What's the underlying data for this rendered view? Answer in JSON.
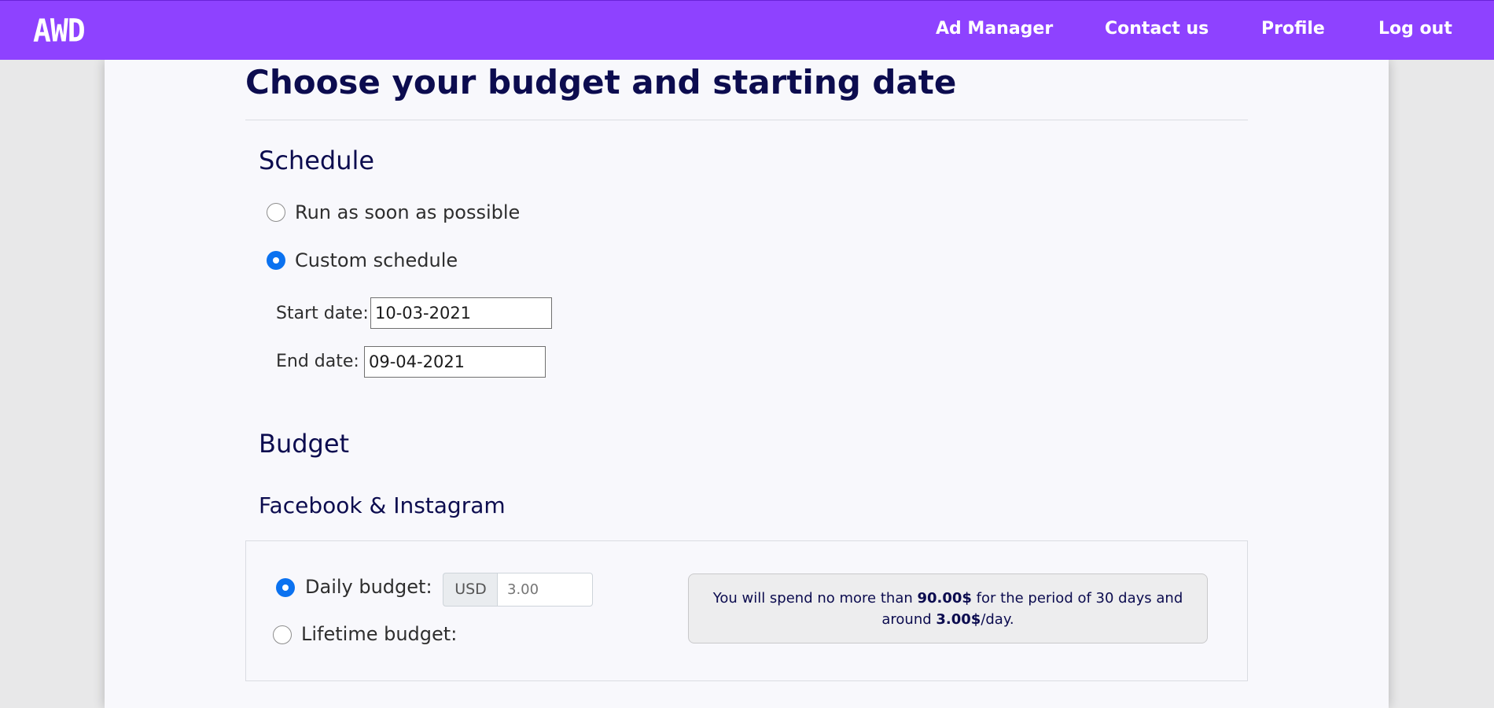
{
  "brand": {
    "logo_text": "AWD"
  },
  "nav": {
    "items": [
      {
        "label": "Ad Manager"
      },
      {
        "label": "Contact us"
      },
      {
        "label": "Profile"
      },
      {
        "label": "Log out"
      }
    ]
  },
  "page": {
    "title": "Choose your budget and starting date"
  },
  "schedule": {
    "heading": "Schedule",
    "options": [
      {
        "label": "Run as soon as possible",
        "selected": false
      },
      {
        "label": "Custom schedule",
        "selected": true
      }
    ],
    "start_label": "Start date:",
    "start_value": "10-03-2021",
    "end_label": "End date:",
    "end_value": "09-04-2021"
  },
  "budget": {
    "heading": "Budget",
    "platform": "Facebook & Instagram",
    "options": [
      {
        "label": "Daily budget:",
        "selected": true
      },
      {
        "label": "Lifetime budget:",
        "selected": false
      }
    ],
    "currency": "USD",
    "amount_placeholder": "3.00",
    "summary": {
      "prefix": "You will spend no more than ",
      "total": "90.00$",
      "middle": " for the period of 30 days and around ",
      "per_day": "3.00$",
      "suffix": "/day."
    }
  },
  "colors": {
    "navbar": "#8e42ff",
    "heading": "#0c0c4f",
    "radio_checked": "#0b72f0"
  }
}
